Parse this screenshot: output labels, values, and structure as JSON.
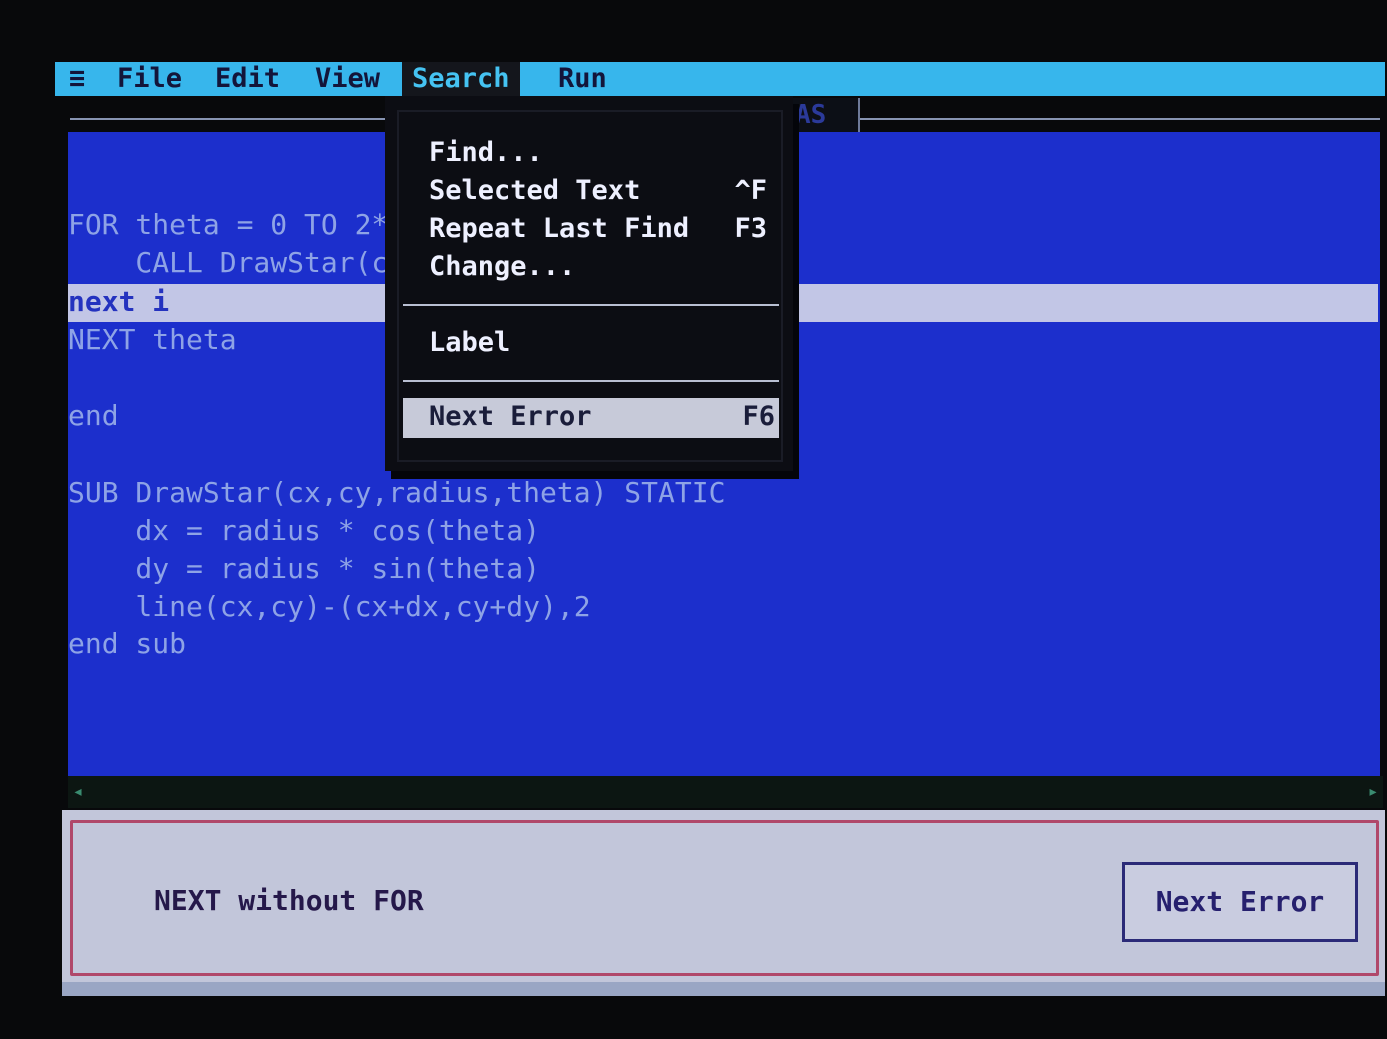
{
  "menubar": {
    "system_glyph": "≡",
    "items": [
      "File",
      "Edit",
      "View",
      "Search",
      "Run"
    ],
    "active": "Search"
  },
  "editor": {
    "title_fragment": "AS",
    "lines": [
      {
        "text": "FOR theta = 0 TO 2*",
        "current": false
      },
      {
        "text": "    CALL DrawStar(c",
        "current": false
      },
      {
        "text": "next i",
        "current": true
      },
      {
        "text": "NEXT theta",
        "current": false
      },
      {
        "text": "",
        "current": false
      },
      {
        "text": "end",
        "current": false
      },
      {
        "text": "",
        "current": false
      },
      {
        "text": "SUB DrawStar(cx,cy,radius,theta) STATIC",
        "current": false
      },
      {
        "text": "    dx = radius * cos(theta)",
        "current": false
      },
      {
        "text": "    dy = radius * sin(theta)",
        "current": false
      },
      {
        "text": "    line(cx,cy)-(cx+dx,cy+dy),2",
        "current": false
      },
      {
        "text": "end sub",
        "current": false
      }
    ]
  },
  "search_menu": {
    "items": [
      {
        "label": "Find...",
        "shortcut": ""
      },
      {
        "label": "Selected Text",
        "shortcut": "^F"
      },
      {
        "label": "Repeat Last Find",
        "shortcut": "F3"
      },
      {
        "label": "Change...",
        "shortcut": ""
      },
      {
        "label": "Label",
        "shortcut": ""
      },
      {
        "label": "Next Error",
        "shortcut": "F6",
        "selected": true
      }
    ]
  },
  "status": {
    "message": "NEXT without FOR",
    "button_label": "Next Error"
  },
  "colors": {
    "menubar": "#37b6ec",
    "editor_background": "#1c2fcc",
    "code_text": "#8ea3e6",
    "menu_background": "#0c0d13",
    "status_background": "#c2c6da",
    "status_border": "#b0486a"
  }
}
